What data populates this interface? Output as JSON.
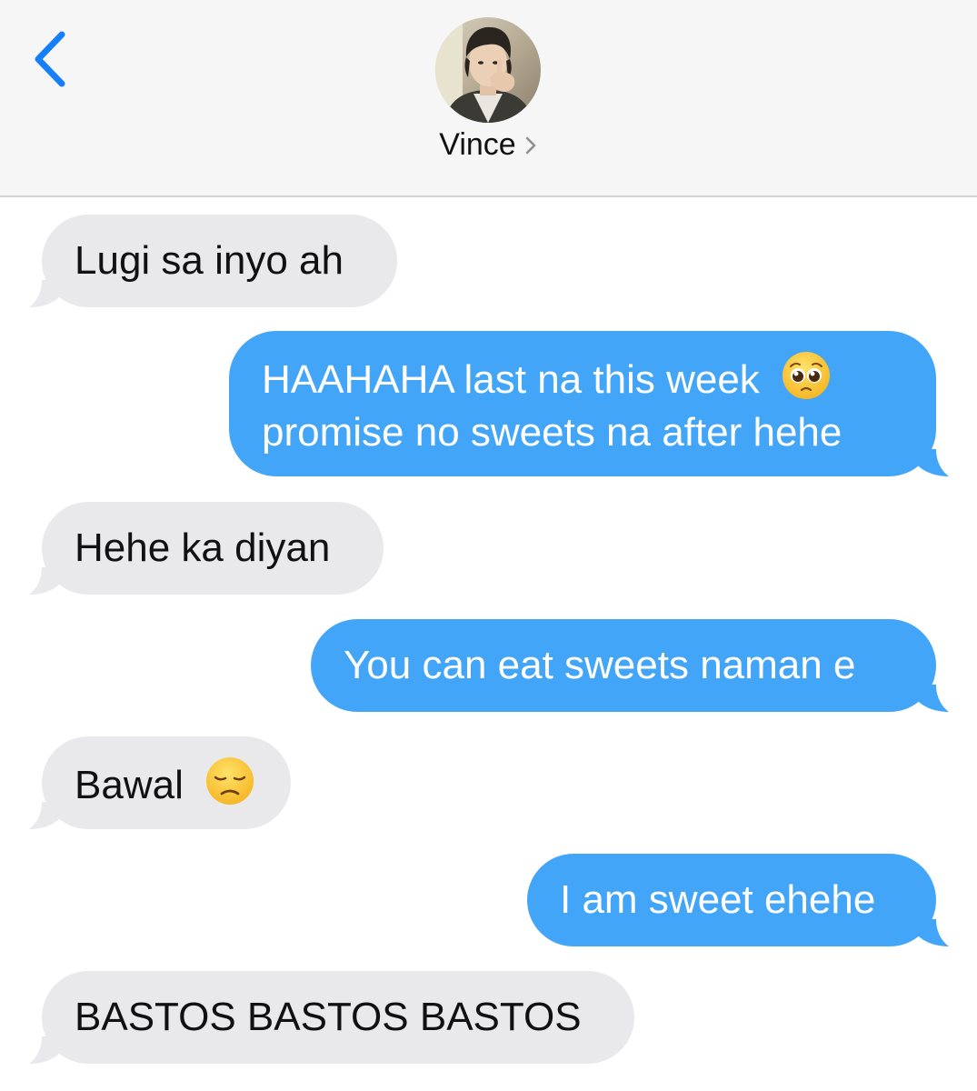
{
  "header": {
    "contact_name": "Vince",
    "back_icon": "chevron-left-icon",
    "detail_icon": "chevron-right-icon",
    "accent_color": "#147efb"
  },
  "colors": {
    "incoming_bubble": "#e9e9eb",
    "outgoing_bubble": "#42a5f8",
    "header_bg": "#f6f6f6"
  },
  "messages": [
    {
      "direction": "incoming",
      "text": "Lugi sa inyo ah"
    },
    {
      "direction": "outgoing",
      "line1": "HAAHAHA last na this week",
      "emoji": "pleading-face-emoji",
      "line2": "promise no sweets na after hehe"
    },
    {
      "direction": "incoming",
      "text": "Hehe ka diyan"
    },
    {
      "direction": "outgoing",
      "text": "You can eat sweets naman e"
    },
    {
      "direction": "incoming",
      "text": "Bawal",
      "emoji": "disappointed-face-emoji"
    },
    {
      "direction": "outgoing",
      "text": "I am sweet ehehe"
    },
    {
      "direction": "incoming",
      "text": "BASTOS BASTOS BASTOS"
    }
  ]
}
